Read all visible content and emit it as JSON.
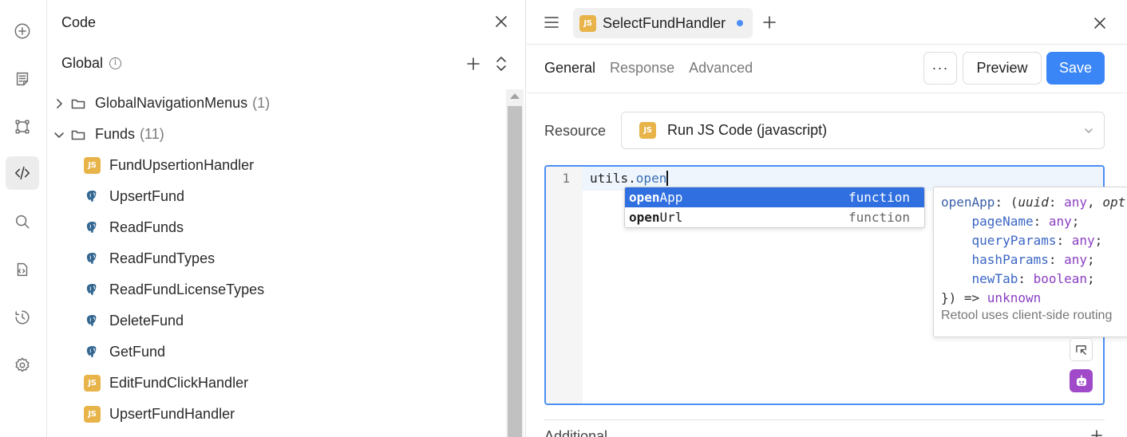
{
  "rail": {
    "items": [
      {
        "name": "add-icon"
      },
      {
        "name": "page-icon"
      },
      {
        "name": "components-icon"
      },
      {
        "name": "code-icon"
      },
      {
        "name": "search-icon"
      },
      {
        "name": "query-library-icon"
      },
      {
        "name": "history-icon"
      },
      {
        "name": "settings-icon"
      }
    ],
    "active": "code-icon"
  },
  "code_panel": {
    "title": "Code",
    "section_label": "Global",
    "tree": [
      {
        "type": "folder",
        "label": "GlobalNavigationMenus",
        "count": "(1)",
        "expanded": false
      },
      {
        "type": "folder",
        "label": "Funds",
        "count": "(11)",
        "expanded": true
      },
      {
        "type": "js",
        "label": "FundUpsertionHandler"
      },
      {
        "type": "postgres",
        "label": "UpsertFund"
      },
      {
        "type": "postgres",
        "label": "ReadFunds"
      },
      {
        "type": "postgres",
        "label": "ReadFundTypes"
      },
      {
        "type": "postgres",
        "label": "ReadFundLicenseTypes"
      },
      {
        "type": "postgres",
        "label": "DeleteFund"
      },
      {
        "type": "postgres",
        "label": "GetFund"
      },
      {
        "type": "js",
        "label": "EditFundClickHandler"
      },
      {
        "type": "js",
        "label": "UpsertFundHandler"
      }
    ]
  },
  "editor": {
    "tab_badge": "JS",
    "tab_title": "SelectFundHandler",
    "subtabs": [
      "General",
      "Response",
      "Advanced"
    ],
    "active_subtab": "General",
    "more_label": "···",
    "preview_label": "Preview",
    "save_label": "Save",
    "resource_label": "Resource",
    "resource_badge": "JS",
    "resource_value": "Run JS Code (javascript)",
    "line_number": "1",
    "code_prefix": "utils.",
    "code_prop": "open",
    "additional_label": "Additional",
    "colors": {
      "accent": "#3b86f7",
      "js_badge": "#e8b44a",
      "ai": "#a04ac9"
    }
  },
  "autocomplete": {
    "items": [
      {
        "match": "open",
        "rest": "App",
        "kind": "function",
        "selected": true
      },
      {
        "match": "open",
        "rest": "Url",
        "kind": "function",
        "selected": false
      }
    ]
  },
  "doc_popup": {
    "fn_name": "openApp",
    "params": [
      {
        "name": "uuid",
        "type": "any"
      },
      {
        "name": "pageName",
        "type": "any"
      },
      {
        "name": "queryParams",
        "type": "any"
      },
      {
        "name": "hashParams",
        "type": "any"
      },
      {
        "name": "newTab",
        "type": "boolean"
      }
    ],
    "opt_fragment": "opt",
    "return_type": "unknown",
    "description": "Retool uses client-side routing"
  }
}
